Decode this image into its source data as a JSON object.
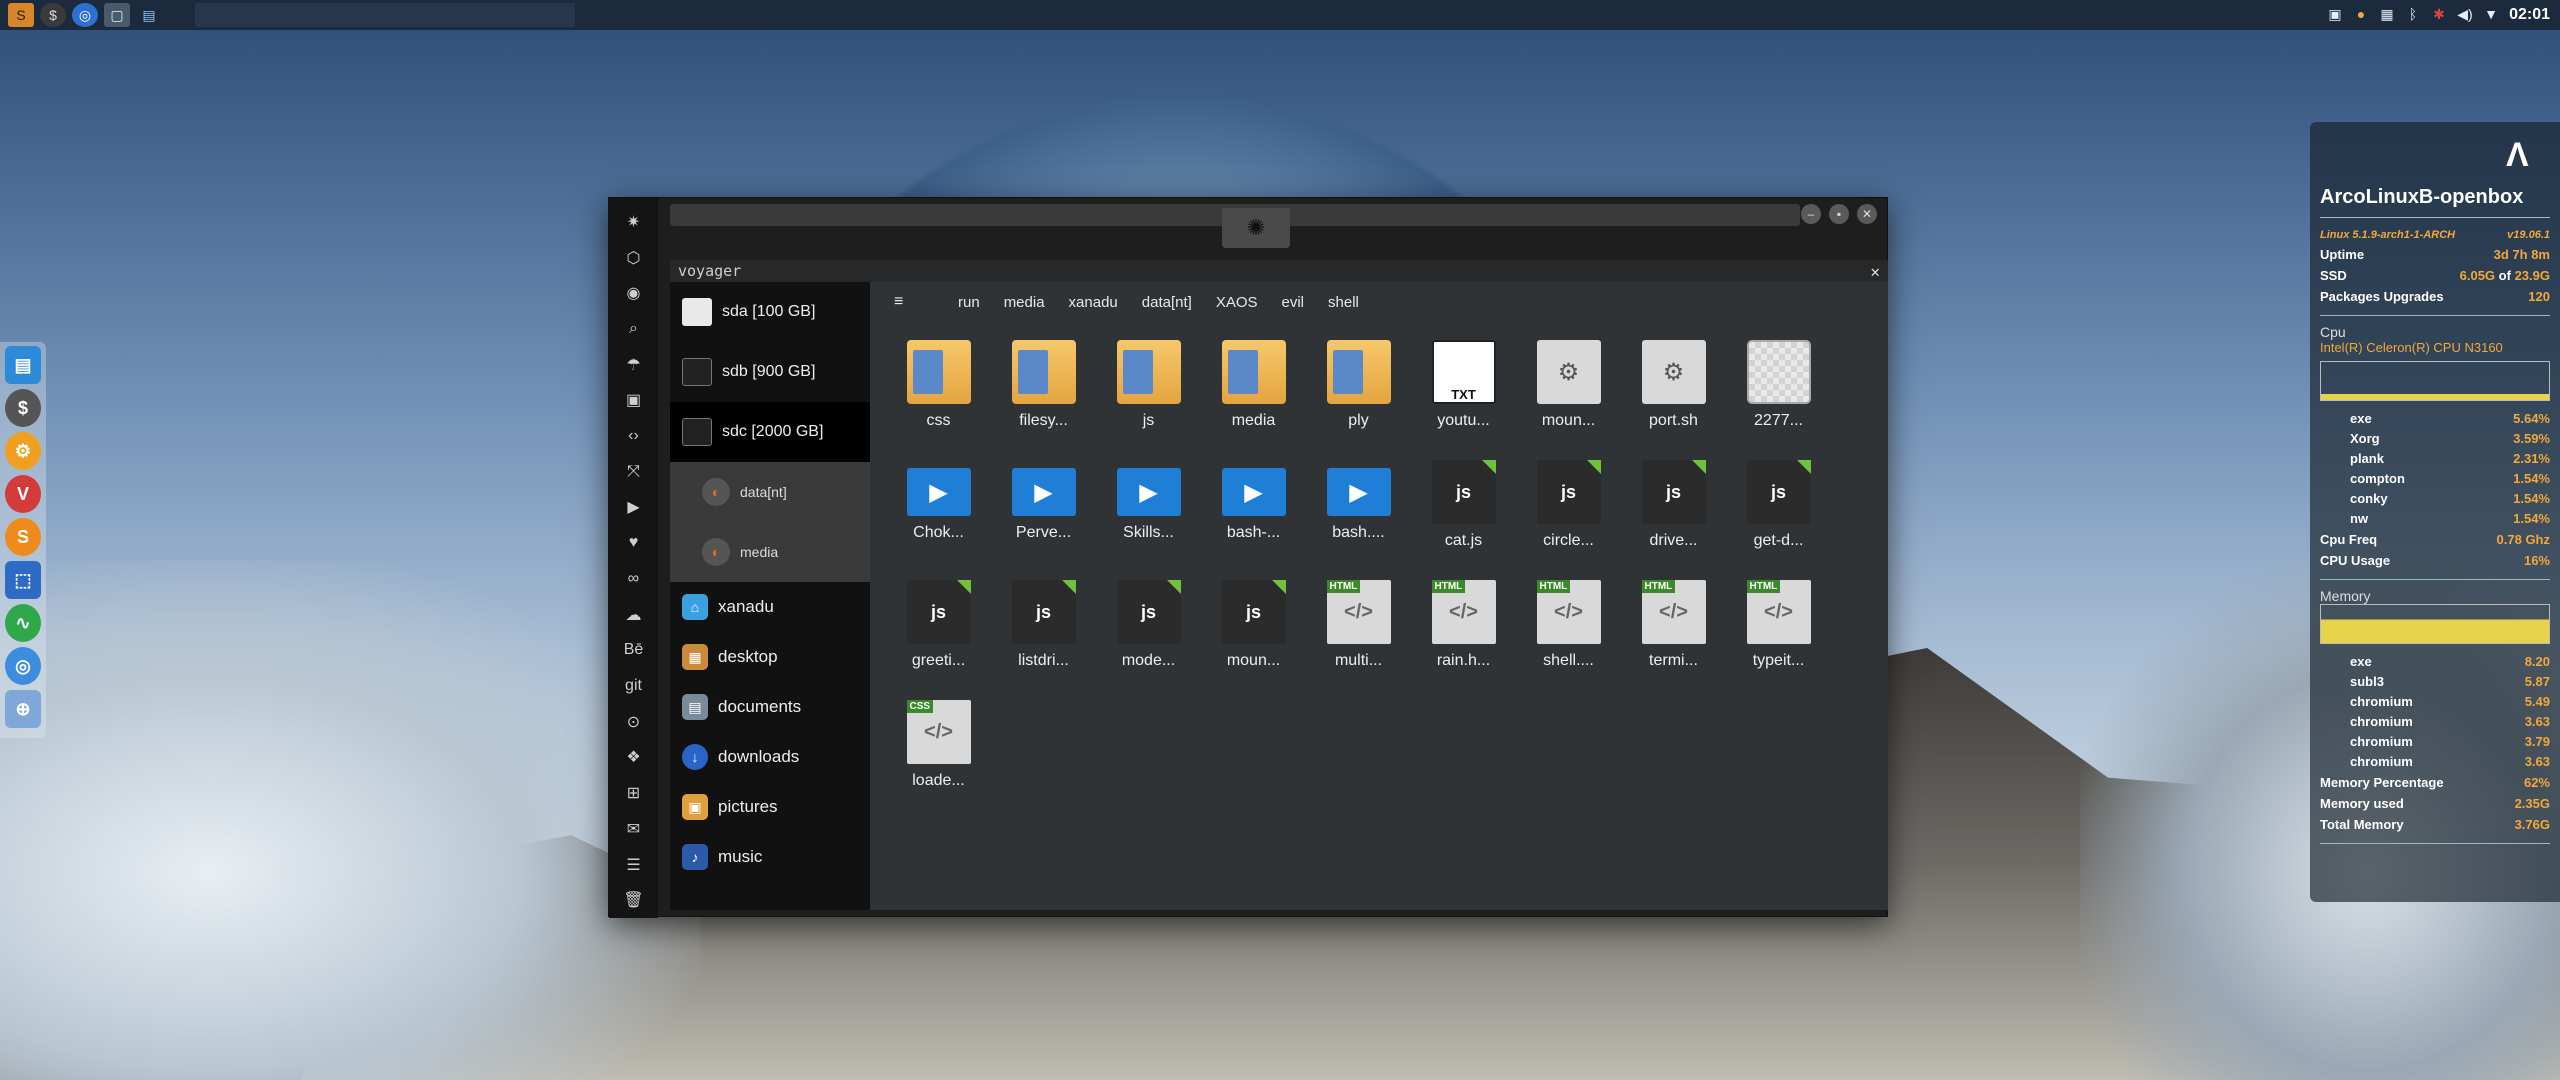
{
  "top_panel": {
    "clock": "02:01"
  },
  "window": {
    "app_title": "voyager"
  },
  "nav": {
    "drives": [
      {
        "label": "sda [100 GB]"
      },
      {
        "label": "sdb [900 GB]"
      },
      {
        "label": "sdc [2000 GB]"
      }
    ],
    "subitems": [
      {
        "label": "data[nt]"
      },
      {
        "label": "media"
      }
    ],
    "places": [
      {
        "label": "xanadu"
      },
      {
        "label": "desktop"
      },
      {
        "label": "documents"
      },
      {
        "label": "downloads"
      },
      {
        "label": "pictures"
      },
      {
        "label": "music"
      }
    ]
  },
  "pathbar": {
    "crumbs": [
      "run",
      "media",
      "xanadu",
      "data[nt]",
      "XAOS",
      "evil",
      "shell"
    ]
  },
  "files": [
    {
      "name": "css",
      "kind": "folder"
    },
    {
      "name": "filesy...",
      "kind": "folder"
    },
    {
      "name": "js",
      "kind": "folder"
    },
    {
      "name": "media",
      "kind": "folder"
    },
    {
      "name": "ply",
      "kind": "folder"
    },
    {
      "name": "youtu...",
      "kind": "txt",
      "badge": "TXT"
    },
    {
      "name": "moun...",
      "kind": "script"
    },
    {
      "name": "port.sh",
      "kind": "script"
    },
    {
      "name": "2277...",
      "kind": "image"
    },
    {
      "name": "Chok...",
      "kind": "video"
    },
    {
      "name": "Perve...",
      "kind": "video"
    },
    {
      "name": "Skills...",
      "kind": "video"
    },
    {
      "name": "bash-...",
      "kind": "video"
    },
    {
      "name": "bash....",
      "kind": "video"
    },
    {
      "name": "cat.js",
      "kind": "js",
      "badge": "js"
    },
    {
      "name": "circle...",
      "kind": "js",
      "badge": "js"
    },
    {
      "name": "drive...",
      "kind": "js",
      "badge": "js"
    },
    {
      "name": "get-d...",
      "kind": "js",
      "badge": "js"
    },
    {
      "name": "greeti...",
      "kind": "js",
      "badge": "js"
    },
    {
      "name": "listdri...",
      "kind": "js",
      "badge": "js"
    },
    {
      "name": "mode...",
      "kind": "js",
      "badge": "js"
    },
    {
      "name": "moun...",
      "kind": "js",
      "badge": "js"
    },
    {
      "name": "multi...",
      "kind": "html",
      "badge": "HTML"
    },
    {
      "name": "rain.h...",
      "kind": "html",
      "badge": "HTML"
    },
    {
      "name": "shell....",
      "kind": "html",
      "badge": "HTML"
    },
    {
      "name": "termi...",
      "kind": "html",
      "badge": "HTML"
    },
    {
      "name": "typeit...",
      "kind": "html",
      "badge": "HTML"
    },
    {
      "name": "loade...",
      "kind": "css",
      "badge": "CSS"
    }
  ],
  "conky": {
    "hostname": "ArcoLinuxB-openbox",
    "kernel": "Linux 5.1.9-arch1-1-ARCH",
    "version": "v19.06.1",
    "uptime_label": "Uptime",
    "uptime": "3d 7h 8m",
    "ssd_label": "SSD",
    "ssd_used": "6.05G",
    "ssd_of": "of",
    "ssd_total": "23.9G",
    "pkg_label": "Packages Upgrades",
    "pkg_count": "120",
    "cpu_label": "Cpu",
    "cpu_model": "Intel(R) Celeron(R) CPU N3160",
    "cpu_procs": [
      {
        "name": "exe",
        "value": "5.64%"
      },
      {
        "name": "Xorg",
        "value": "3.59%"
      },
      {
        "name": "plank",
        "value": "2.31%"
      },
      {
        "name": "compton",
        "value": "1.54%"
      },
      {
        "name": "conky",
        "value": "1.54%"
      },
      {
        "name": "nw",
        "value": "1.54%"
      }
    ],
    "cpu_freq_label": "Cpu Freq",
    "cpu_freq": "0.78 Ghz",
    "cpu_usage_label": "CPU Usage",
    "cpu_usage": "16%",
    "mem_label": "Memory",
    "mem_procs": [
      {
        "name": "exe",
        "value": "8.20"
      },
      {
        "name": "subl3",
        "value": "5.87"
      },
      {
        "name": "chromium",
        "value": "5.49"
      },
      {
        "name": "chromium",
        "value": "3.63"
      },
      {
        "name": "chromium",
        "value": "3.79"
      },
      {
        "name": "chromium",
        "value": "3.63"
      }
    ],
    "mem_pct_label": "Memory Percentage",
    "mem_pct": "62%",
    "mem_used_label": "Memory used",
    "mem_used": "2.35G",
    "mem_total_label": "Total Memory",
    "mem_total": "3.76G",
    "cpu_graph_fill": 0.16,
    "mem_graph_fill": 0.62
  }
}
